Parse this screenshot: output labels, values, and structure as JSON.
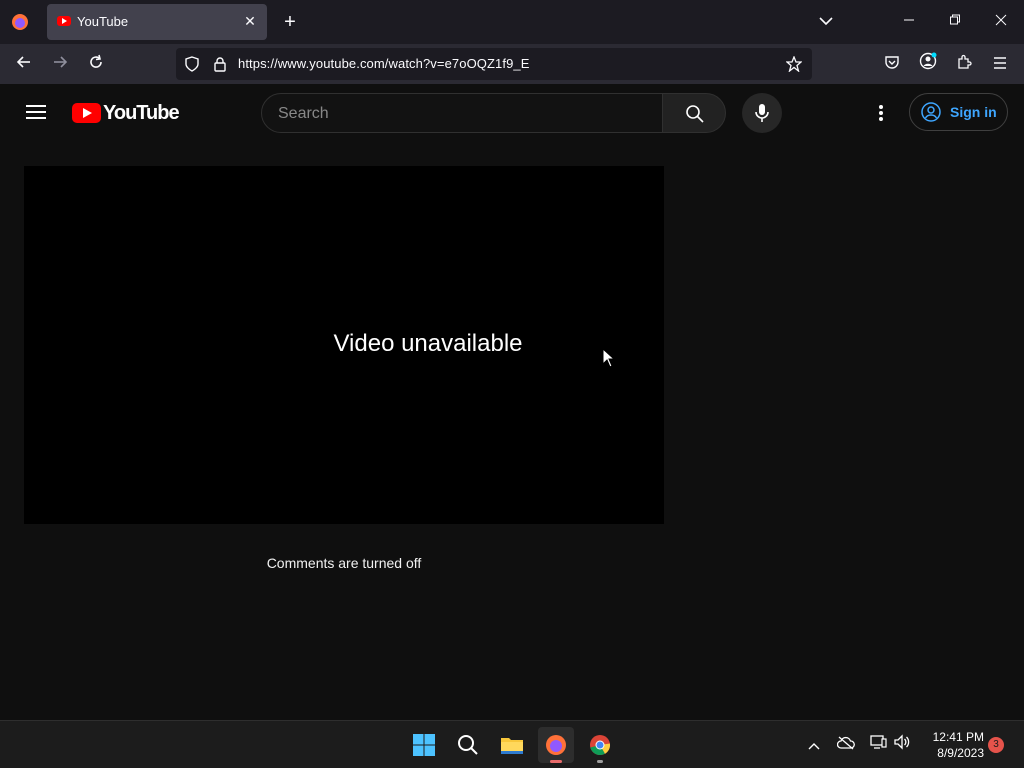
{
  "browser": {
    "tab_title": "YouTube",
    "url": "https://www.youtube.com/watch?v=e7oOQZ1f9_E"
  },
  "youtube": {
    "logo_text": "YouTube",
    "search_placeholder": "Search",
    "sign_in_label": "Sign in"
  },
  "player": {
    "message": "Video unavailable"
  },
  "comments": {
    "status": "Comments are turned off"
  },
  "taskbar": {
    "time": "12:41 PM",
    "date": "8/9/2023",
    "notification_count": "3"
  },
  "colors": {
    "youtube_red": "#ff0000",
    "sign_in_blue": "#3ea6ff",
    "page_bg": "#0f0f0f"
  }
}
